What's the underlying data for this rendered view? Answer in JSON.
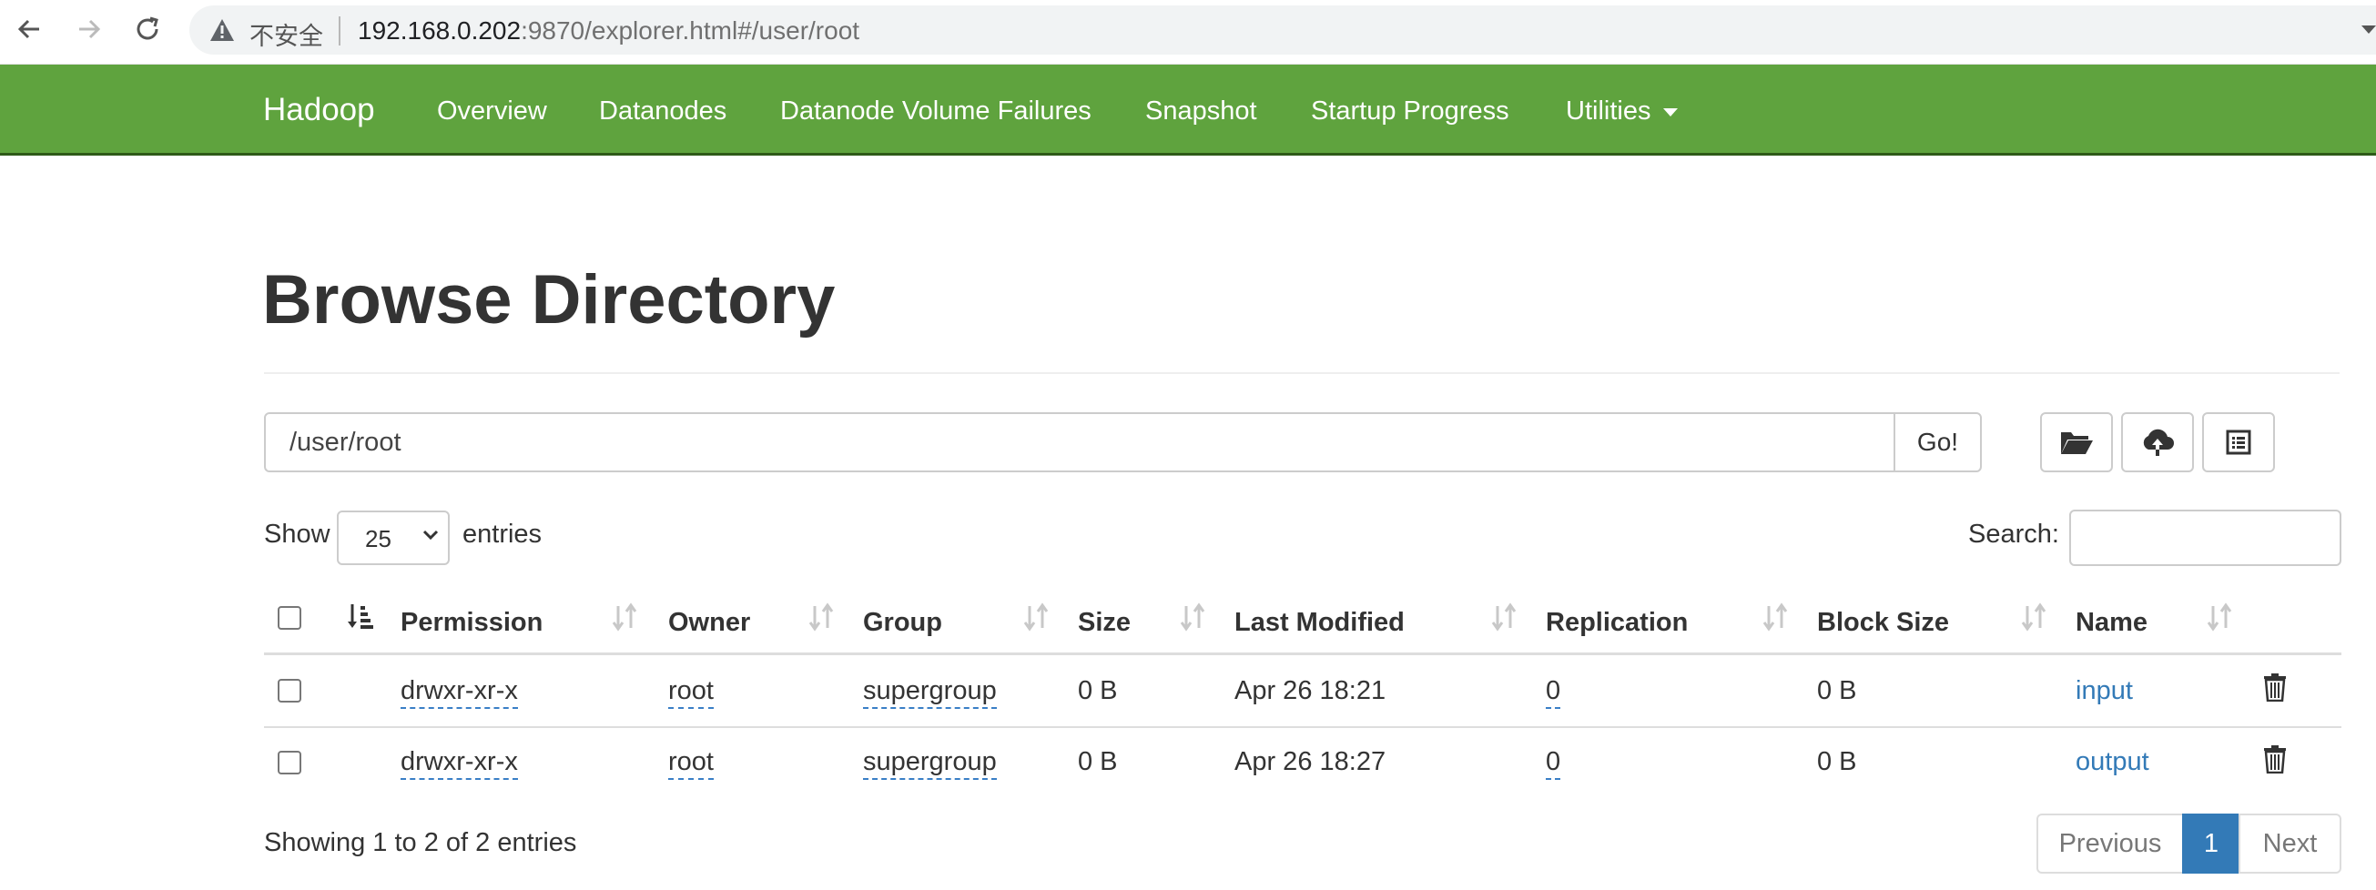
{
  "browser": {
    "security_label": "不安全",
    "url_host": "192.168.0.202",
    "url_rest": ":9870/explorer.html#/user/root"
  },
  "navbar": {
    "brand": "Hadoop",
    "links": [
      "Overview",
      "Datanodes",
      "Datanode Volume Failures",
      "Snapshot",
      "Startup Progress",
      "Utilities"
    ]
  },
  "page": {
    "title": "Browse Directory",
    "path_value": "/user/root",
    "go_label": "Go!",
    "show_label": "Show",
    "entries_value": "25",
    "entries_label": "entries",
    "search_label": "Search:",
    "search_value": ""
  },
  "table": {
    "columns": [
      "Permission",
      "Owner",
      "Group",
      "Size",
      "Last Modified",
      "Replication",
      "Block Size",
      "Name"
    ],
    "rows": [
      {
        "permission": "drwxr-xr-x",
        "owner": "root",
        "group": "supergroup",
        "size": "0 B",
        "last_modified": "Apr 26 18:21",
        "replication": "0",
        "block_size": "0 B",
        "name": "input"
      },
      {
        "permission": "drwxr-xr-x",
        "owner": "root",
        "group": "supergroup",
        "size": "0 B",
        "last_modified": "Apr 26 18:27",
        "replication": "0",
        "block_size": "0 B",
        "name": "output"
      }
    ]
  },
  "footer": {
    "info": "Showing 1 to 2 of 2 entries",
    "previous": "Previous",
    "page": "1",
    "next": "Next"
  },
  "icons": {
    "back": "back-arrow-icon",
    "forward": "forward-arrow-icon",
    "reload": "reload-icon",
    "warning": "warning-icon",
    "folder": "folder-open-icon",
    "upload": "cloud-upload-icon",
    "list": "list-icon",
    "trash": "trash-icon"
  },
  "colors": {
    "navbar": "#5fa33e",
    "link": "#337ab7",
    "pager_active": "#337ab7"
  }
}
